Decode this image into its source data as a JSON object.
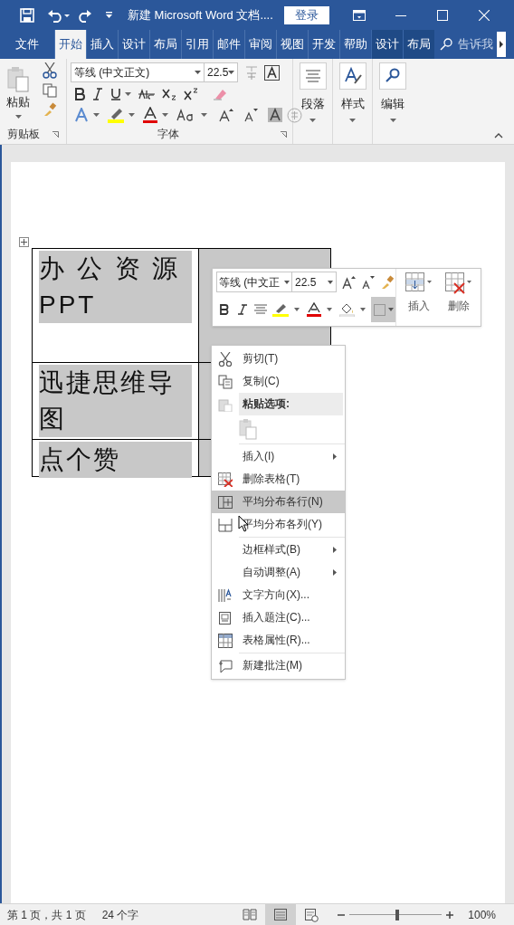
{
  "title_bar": {
    "title": "新建 Microsoft Word 文档....",
    "login": "登录"
  },
  "tabs": [
    {
      "label": "文件",
      "selected": false,
      "kind": "file"
    },
    {
      "label": "开始",
      "selected": true,
      "kind": "normal"
    },
    {
      "label": "插入",
      "selected": false,
      "kind": "normal"
    },
    {
      "label": "设计",
      "selected": false,
      "kind": "normal"
    },
    {
      "label": "布局",
      "selected": false,
      "kind": "normal"
    },
    {
      "label": "引用",
      "selected": false,
      "kind": "normal"
    },
    {
      "label": "邮件",
      "selected": false,
      "kind": "normal"
    },
    {
      "label": "审阅",
      "selected": false,
      "kind": "normal"
    },
    {
      "label": "视图",
      "selected": false,
      "kind": "normal"
    },
    {
      "label": "开发",
      "selected": false,
      "kind": "normal"
    },
    {
      "label": "帮助",
      "selected": false,
      "kind": "normal"
    },
    {
      "label": "设计",
      "selected": false,
      "kind": "contextual"
    },
    {
      "label": "布局",
      "selected": false,
      "kind": "contextual"
    }
  ],
  "tell_me": "告诉我",
  "ribbon": {
    "clipboard": {
      "paste": "粘贴",
      "label": "剪贴板"
    },
    "font": {
      "font_name": "等线 (中文正文)",
      "font_size": "22.5",
      "label": "字体"
    },
    "groups": [
      {
        "label": "段落",
        "kind": "paragraph"
      },
      {
        "label": "样式",
        "kind": "styles"
      },
      {
        "label": "编辑",
        "kind": "editing"
      }
    ]
  },
  "table": {
    "rows": [
      {
        "first_cell": [
          "办 公 资 源",
          "PPT"
        ]
      },
      {
        "first_cell": [
          "迅捷思维导",
          "图"
        ]
      },
      {
        "first_cell": [
          "点个赞"
        ]
      }
    ]
  },
  "mini_toolbar": {
    "font_name": "等线 (中文正",
    "font_size": "22.5",
    "insert": "插入",
    "delete": "删除"
  },
  "context_menu": [
    {
      "kind": "cut",
      "label": "剪切(T)",
      "selected": false
    },
    {
      "kind": "copy",
      "label": "复制(C)",
      "selected": false
    },
    {
      "kind": "paste-header",
      "label": "粘贴选项:",
      "selected": false
    },
    {
      "kind": "paste-option",
      "selected": false
    },
    {
      "kind": "separator"
    },
    {
      "kind": "submenu",
      "label": "插入(I)",
      "selected": false
    },
    {
      "kind": "delete-table",
      "label": "删除表格(T)",
      "selected": false
    },
    {
      "kind": "distribute-rows",
      "label": "平均分布各行(N)",
      "selected": true
    },
    {
      "kind": "distribute-columns",
      "label": "平均分布各列(Y)",
      "selected": false
    },
    {
      "kind": "separator"
    },
    {
      "kind": "submenu",
      "label": "边框样式(B)",
      "selected": false
    },
    {
      "kind": "submenu",
      "label": "自动调整(A)",
      "selected": false
    },
    {
      "kind": "text-direction",
      "label": "文字方向(X)...",
      "selected": false
    },
    {
      "kind": "caption",
      "label": "插入题注(C)...",
      "selected": false
    },
    {
      "kind": "properties",
      "label": "表格属性(R)...",
      "selected": false
    },
    {
      "kind": "separator"
    },
    {
      "kind": "comment",
      "label": "新建批注(M)",
      "selected": false
    }
  ],
  "status_bar": {
    "page": "第 1 页，共 1 页",
    "words": "24 个字",
    "views": [
      {
        "kind": "read",
        "selected": false
      },
      {
        "kind": "print",
        "selected": true
      },
      {
        "kind": "web",
        "selected": false
      }
    ],
    "zoom": {
      "level": 0.52,
      "reading": "100%"
    }
  }
}
